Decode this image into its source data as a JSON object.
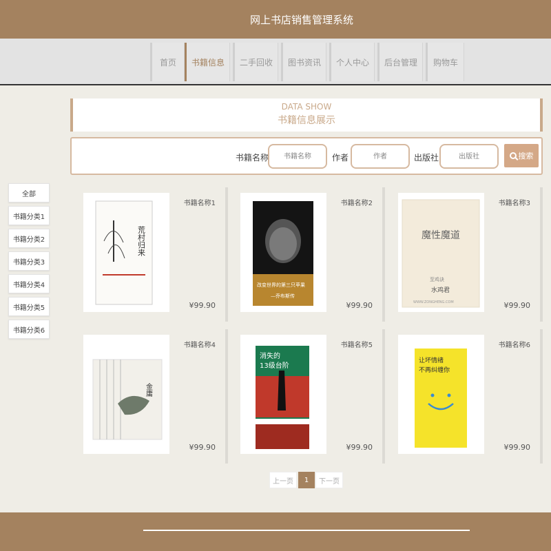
{
  "header": {
    "title": "网上书店销售管理系统"
  },
  "nav": [
    {
      "label": "首页"
    },
    {
      "label": "书籍信息"
    },
    {
      "label": "二手回收"
    },
    {
      "label": "图书资讯"
    },
    {
      "label": "个人中心"
    },
    {
      "label": "后台管理"
    },
    {
      "label": "购物车"
    }
  ],
  "banner": {
    "en": "DATA SHOW",
    "cn": "书籍信息展示"
  },
  "search": {
    "name_label": "书籍名称",
    "name_placeholder": "书籍名称",
    "author_label": "作者",
    "author_placeholder": "作者",
    "publisher_label": "出版社",
    "publisher_placeholder": "出版社",
    "button": "搜索"
  },
  "categories": [
    "全部",
    "书籍分类1",
    "书籍分类2",
    "书籍分类3",
    "书籍分类4",
    "书籍分类5",
    "书籍分类6"
  ],
  "books": [
    {
      "name": "书籍名称1",
      "price": "¥99.90",
      "cover_title": "荒村归来",
      "cover_color": "#ffffff"
    },
    {
      "name": "书籍名称2",
      "price": "¥99.90",
      "cover_title": "改变世界的第三只苹果——乔布斯传",
      "cover_color": "#1a1a1a"
    },
    {
      "name": "书籍名称3",
      "price": "¥99.90",
      "cover_title": "魔性魔道",
      "cover_author": "水鸡君",
      "cover_color": "#f3ebdb"
    },
    {
      "name": "书籍名称4",
      "price": "¥99.90",
      "cover_title": "金庸",
      "cover_color": "#f2f0ea"
    },
    {
      "name": "书籍名称5",
      "price": "¥99.90",
      "cover_title": "消失的13级台阶",
      "cover_color": "#c0392b"
    },
    {
      "name": "书籍名称6",
      "price": "¥99.90",
      "cover_title": "让坏情绪不再纠缠你",
      "cover_color": "#f5e32a"
    }
  ],
  "pagination": {
    "prev": "上一页",
    "current": "1",
    "next": "下一页"
  },
  "colors": {
    "brand": "#a4825f",
    "accent": "#d4a887"
  }
}
